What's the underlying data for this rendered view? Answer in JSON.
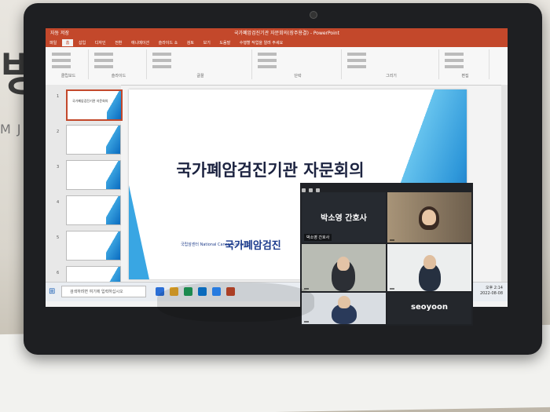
{
  "wall_sign": {
    "big": "병",
    "sub": "MJ"
  },
  "powerpoint": {
    "title": "국가폐암검진기관 자문회의(장주용결) - PowerPoint",
    "quick_access": "자동 저장",
    "tabs": [
      "파일",
      "홈",
      "삽입",
      "디자인",
      "전환",
      "애니메이션",
      "슬라이드 쇼",
      "검토",
      "보기",
      "도움말",
      "수행할 작업을 알려 주세요"
    ],
    "ribbon_groups": [
      "클립보드",
      "슬라이드",
      "글꼴",
      "단락",
      "그리기",
      "편집"
    ]
  },
  "thumbnails": [
    {
      "num": "1",
      "text": "국가폐암검진기관 자문회의"
    },
    {
      "num": "2",
      "text": ""
    },
    {
      "num": "3",
      "text": ""
    },
    {
      "num": "4",
      "text": ""
    },
    {
      "num": "5",
      "text": ""
    },
    {
      "num": "6",
      "text": ""
    }
  ],
  "slide": {
    "title": "국가폐암검진기관 자문회의",
    "logo_text": "국립암센터 National Cancer Center",
    "org": "국가폐암검진"
  },
  "taskbar": {
    "search_placeholder": "검색하려면 여기에 입력하십시오",
    "time": "오후 2:14",
    "date": "2022-08-08"
  },
  "zoom": {
    "participant_big_name": "박소영 간호사",
    "tiles": [
      {
        "chip": "박소영 간호사"
      },
      {
        "chip": ""
      },
      {
        "chip": ""
      },
      {
        "chip": ""
      },
      {
        "chip": ""
      },
      {
        "chip": "seoyoon"
      }
    ],
    "big_name_2": "seoyoon"
  },
  "colors": {
    "ppt_accent": "#c3482b",
    "slide_blue": "#0b59b0",
    "title_navy": "#1c2340"
  }
}
